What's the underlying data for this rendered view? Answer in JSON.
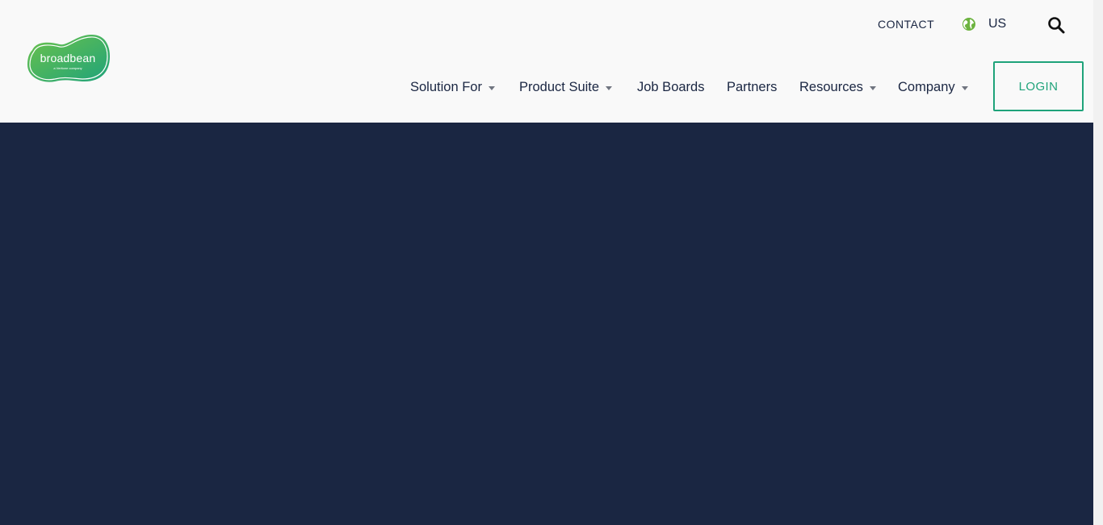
{
  "logo": {
    "name": "broadbean",
    "tagline": "a Veritone company"
  },
  "utility": {
    "contact_label": "CONTACT",
    "region_label": "US"
  },
  "nav": {
    "items": [
      {
        "label": "Solution For",
        "has_dropdown": true
      },
      {
        "label": "Product Suite",
        "has_dropdown": true
      },
      {
        "label": "Job Boards",
        "has_dropdown": false
      },
      {
        "label": "Partners",
        "has_dropdown": false
      },
      {
        "label": "Resources",
        "has_dropdown": true
      },
      {
        "label": "Company",
        "has_dropdown": true
      }
    ]
  },
  "login_label": "LOGIN",
  "icons": {
    "globe": "globe-icon",
    "search": "search-icon",
    "dropdown": "caret-down-icon"
  },
  "colors": {
    "accent_green": "#1fa37a",
    "navy": "#1a2642",
    "header_bg": "#f9f9f9"
  }
}
